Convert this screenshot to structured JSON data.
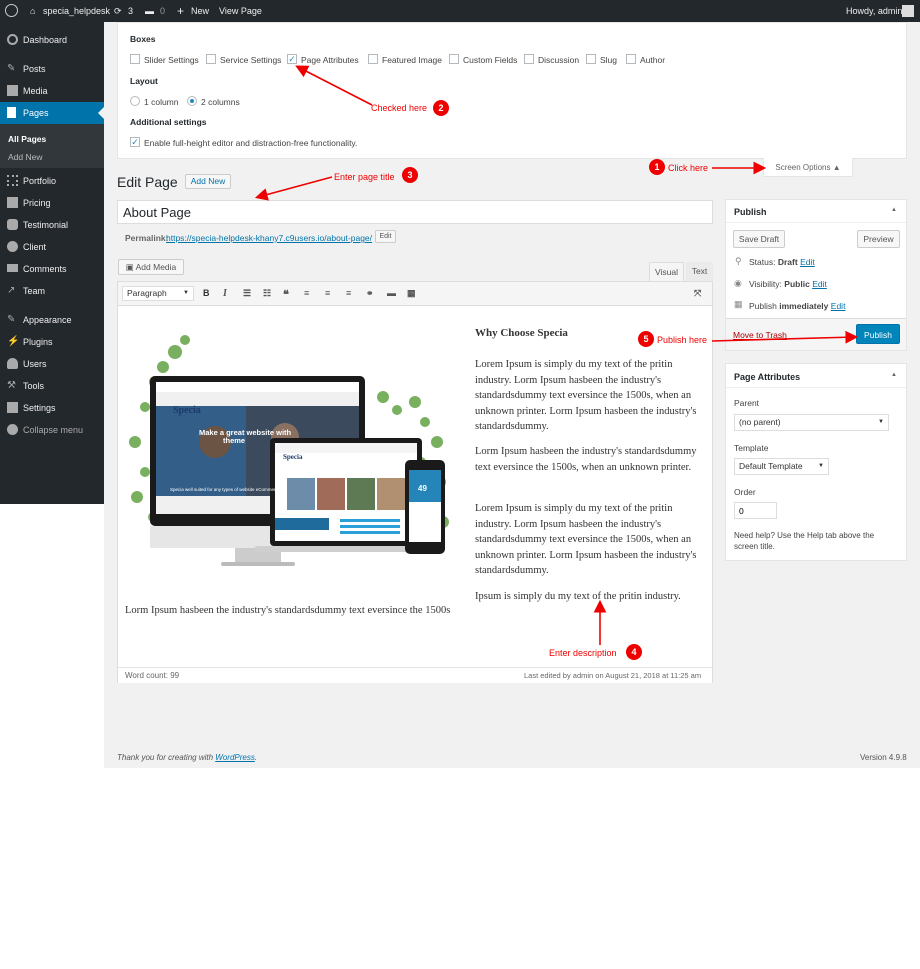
{
  "adminbar": {
    "site": "specia_helpdesk",
    "updates": "3",
    "comments": "0",
    "new": "New",
    "view_page": "View Page",
    "howdy": "Howdy, admin"
  },
  "menu": {
    "dashboard": "Dashboard",
    "posts": "Posts",
    "media": "Media",
    "pages": "Pages",
    "all_pages": "All Pages",
    "add_new": "Add New",
    "portfolio": "Portfolio",
    "pricing": "Pricing",
    "testimonial": "Testimonial",
    "client": "Client",
    "comments": "Comments",
    "team": "Team",
    "appearance": "Appearance",
    "plugins": "Plugins",
    "users": "Users",
    "tools": "Tools",
    "settings": "Settings",
    "collapse": "Collapse menu"
  },
  "screen_options": {
    "boxes_heading": "Boxes",
    "boxes": {
      "slider": "Slider Settings",
      "service": "Service Settings",
      "page_attr": "Page Attributes",
      "featured": "Featured Image",
      "custom": "Custom Fields",
      "discussion": "Discussion",
      "slug": "Slug",
      "author": "Author"
    },
    "checked": [
      "page_attr"
    ],
    "layout_heading": "Layout",
    "col1": "1 column",
    "col2": "2 columns",
    "selected_layout": "2 columns",
    "additional_heading": "Additional settings",
    "fullheight": "Enable full-height editor and distraction-free functionality.",
    "toggle": "Screen Options ▲"
  },
  "annotations": {
    "a1": "Click here",
    "a2": "Checked here",
    "a3": "Enter page title",
    "a4": "Enter description",
    "a5": "Publish here",
    "n1": "1",
    "n2": "2",
    "n3": "3",
    "n4": "4",
    "n5": "5"
  },
  "editor": {
    "heading": "Edit Page",
    "add_new": "Add New",
    "title_value": "About Page",
    "permalink_label": "Permalink:",
    "permalink_url": "https://specia-helpdesk-khany7.c9users.io/about-page/",
    "edit": "Edit",
    "add_media": "Add Media",
    "tab_visual": "Visual",
    "tab_text": "Text",
    "format": "Paragraph",
    "word_count": "Word count: 99",
    "last_edited": "Last edited by admin on August 21, 2018 at 11:25 am"
  },
  "body": {
    "heading": "Why Choose Specia",
    "p1": "Lorem Ipsum is simply du my text of the pritin industry. Lorm Ipsum hasbeen the industry's standardsdummy text eversince the 1500s, when an unknown printer. Lorm Ipsum hasbeen the industry's standardsdummy.",
    "p2": "Lorm Ipsum hasbeen the industry's standardsdummy text eversince the 1500s, when an unknown printer.",
    "p3": "Lorem Ipsum is simply du my text of the pritin industry. Lorm Ipsum hasbeen the industry's standardsdummy text eversince the 1500s, when an unknown printer. Lorm Ipsum hasbeen the industry's standardsdummy.",
    "p4a": "Ipsum is simply du my text of the pritin industry.",
    "p4b": "Lorm Ipsum hasbeen the industry's standardsdummy text eversince the 1500s"
  },
  "mockup": {
    "brand": "Specia",
    "hero": "Make a great website with",
    "theme": "theme",
    "tag": "Specia well suited for any types of website eCommerce",
    "screen_num": "49"
  },
  "publish": {
    "title": "Publish",
    "save_draft": "Save Draft",
    "preview": "Preview",
    "status_label": "Status:",
    "status_value": "Draft",
    "visibility_label": "Visibility:",
    "visibility_value": "Public",
    "publish_label": "Publish",
    "publish_value": "immediately",
    "edit": "Edit",
    "trash": "Move to Trash",
    "publish_btn": "Publish"
  },
  "attributes": {
    "title": "Page Attributes",
    "parent_label": "Parent",
    "parent_value": "(no parent)",
    "template_label": "Template",
    "template_value": "Default Template",
    "order_label": "Order",
    "order_value": "0",
    "help": "Need help? Use the Help tab above the screen title."
  },
  "footer": {
    "thanks": "Thank you for creating with",
    "wp": "WordPress",
    "period": ".",
    "version": "Version 4.9.8"
  },
  "colors": {
    "accent": "#0073aa",
    "annotation": "#e00000",
    "adminbar": "#23282d"
  }
}
